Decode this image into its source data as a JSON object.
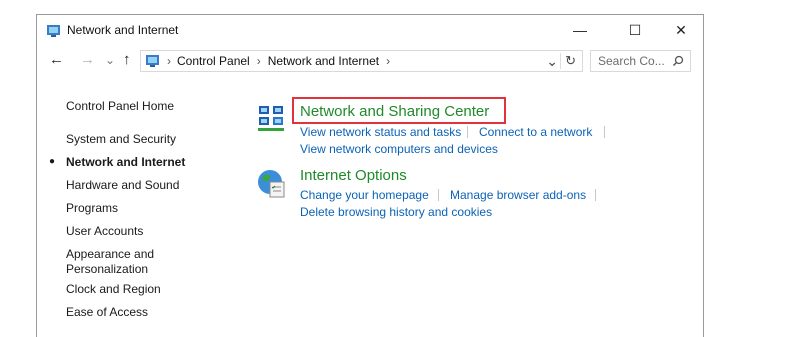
{
  "window": {
    "title": "Network and Internet",
    "minimize": "—",
    "maximize": "☐",
    "close": "✕"
  },
  "nav": {
    "back": "←",
    "forward": "→",
    "dropdown": "⌄",
    "up": "↑",
    "breadcrumb": [
      "Control Panel",
      "Network and Internet"
    ],
    "refresh": "↻",
    "search_placeholder": "Search Co..."
  },
  "sidebar": {
    "items": [
      {
        "label": "Control Panel Home"
      },
      {
        "label": "System and Security"
      },
      {
        "label": "Network and Internet",
        "active": true
      },
      {
        "label": "Hardware and Sound"
      },
      {
        "label": "Programs"
      },
      {
        "label": "User Accounts"
      },
      {
        "label": "Appearance and"
      },
      {
        "label": "Personalization"
      },
      {
        "label": "Clock and Region"
      },
      {
        "label": "Ease of Access"
      }
    ]
  },
  "categories": {
    "network": {
      "title": "Network and Sharing Center",
      "links": [
        "View network status and tasks",
        "Connect to a network",
        "View network computers and devices"
      ]
    },
    "internet": {
      "title": "Internet Options",
      "links": [
        "Change your homepage",
        "Manage browser add-ons",
        "Delete browsing history and cookies"
      ]
    }
  },
  "colors": {
    "category_title": "#1f8a2a",
    "link": "#0b63b6",
    "highlight": "#e0333b"
  }
}
